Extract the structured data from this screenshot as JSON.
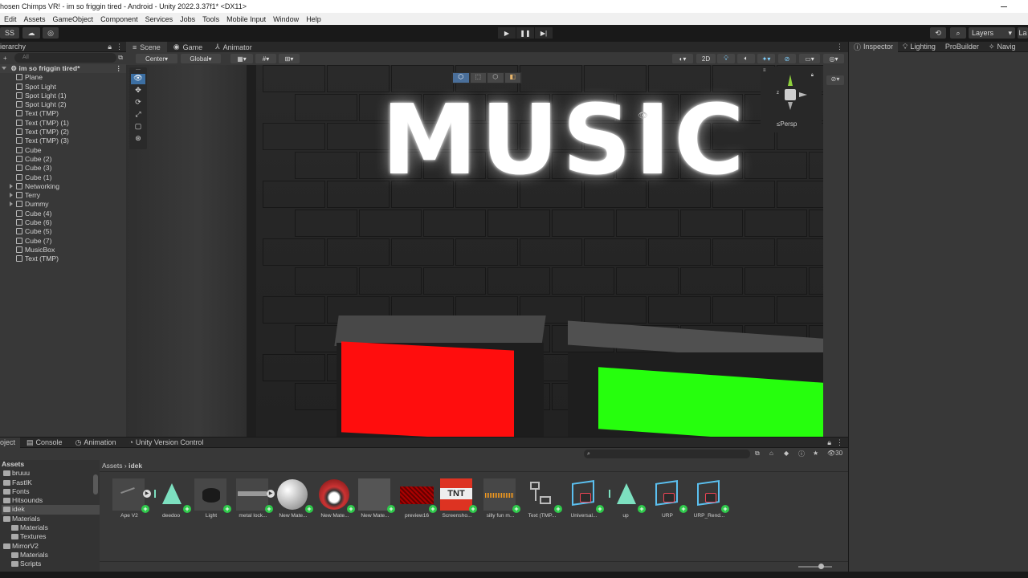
{
  "window": {
    "title": "hosen Chimps VR! - im so friggin tired - Android - Unity 2022.3.37f1* <DX11>"
  },
  "menu": [
    "Edit",
    "Assets",
    "GameObject",
    "Component",
    "Services",
    "Jobs",
    "Tools",
    "Mobile Input",
    "Window",
    "Help"
  ],
  "toolbar": {
    "account_label": "SS",
    "layers_label": "Layers",
    "layout_label": "La"
  },
  "hierarchy": {
    "tab_label": "ierarchy",
    "search_placeholder": "All",
    "scene_name": "im so friggin tired*",
    "items": [
      {
        "label": "Plane",
        "expandable": false
      },
      {
        "label": "Spot Light",
        "expandable": false
      },
      {
        "label": "Spot Light (1)",
        "expandable": false
      },
      {
        "label": "Spot Light (2)",
        "expandable": false
      },
      {
        "label": "Text (TMP)",
        "expandable": false
      },
      {
        "label": "Text (TMP) (1)",
        "expandable": false
      },
      {
        "label": "Text (TMP) (2)",
        "expandable": false
      },
      {
        "label": "Text (TMP) (3)",
        "expandable": false
      },
      {
        "label": "Cube",
        "expandable": false
      },
      {
        "label": "Cube (2)",
        "expandable": false
      },
      {
        "label": "Cube (3)",
        "expandable": false
      },
      {
        "label": "Cube (1)",
        "expandable": false
      },
      {
        "label": "Networking",
        "expandable": true
      },
      {
        "label": "Terry",
        "expandable": true
      },
      {
        "label": "Dummy",
        "expandable": true
      },
      {
        "label": "Cube (4)",
        "expandable": false
      },
      {
        "label": "Cube (6)",
        "expandable": false
      },
      {
        "label": "Cube (5)",
        "expandable": false
      },
      {
        "label": "Cube (7)",
        "expandable": false
      },
      {
        "label": "MusicBox",
        "expandable": false
      },
      {
        "label": "Text (TMP)",
        "expandable": false
      }
    ]
  },
  "scene": {
    "tabs": [
      "Scene",
      "Game",
      "Animator"
    ],
    "pivot_label": "Center",
    "space_label": "Global",
    "mode_2d": "2D",
    "persp_label": "Persp",
    "world_text": "MUSIC",
    "colors": {
      "red_block": "#ff0d0d",
      "green_block": "#26ff0d"
    }
  },
  "inspector": {
    "tabs": [
      "Inspector",
      "Lighting",
      "ProBuilder",
      "Navig"
    ]
  },
  "project": {
    "tabs": [
      "oject",
      "Console",
      "Animation",
      "Unity Version Control"
    ],
    "breadcrumb": [
      "Assets",
      "idek"
    ],
    "item_count": "30",
    "tree": [
      {
        "label": "Assets",
        "level": 0,
        "bold": true
      },
      {
        "label": "bruuu",
        "level": 0
      },
      {
        "label": "FastIK",
        "level": 0
      },
      {
        "label": "Fonts",
        "level": 0
      },
      {
        "label": "Hitsounds",
        "level": 0
      },
      {
        "label": "idek",
        "level": 0,
        "selected": true
      },
      {
        "label": "Materials",
        "level": 0
      },
      {
        "label": "Materials",
        "level": 1
      },
      {
        "label": "Textures",
        "level": 1
      },
      {
        "label": "MirrorV2",
        "level": 0
      },
      {
        "label": "Materials",
        "level": 1
      },
      {
        "label": "Scripts",
        "level": 1
      }
    ],
    "assets": [
      {
        "label": "Ape V2",
        "icon": "model-icon"
      },
      {
        "label": "deedoo",
        "icon": "cone-icon"
      },
      {
        "label": "Light",
        "icon": "cylinder-icon"
      },
      {
        "label": "metal lock...",
        "icon": "plank-icon"
      },
      {
        "label": "New Mate...",
        "icon": "sphere-icon"
      },
      {
        "label": "New Mate...",
        "icon": "red-sphere-icon"
      },
      {
        "label": "New Mate...",
        "icon": "grey-square-icon"
      },
      {
        "label": "preview16",
        "icon": "red-texture-icon"
      },
      {
        "label": "Screensho...",
        "icon": "tnt-icon"
      },
      {
        "label": "silly fun m...",
        "icon": "audio-icon"
      },
      {
        "label": "Text (TMP...",
        "icon": "prefab-link-icon"
      },
      {
        "label": "Universal...",
        "icon": "box-icon"
      },
      {
        "label": "up",
        "icon": "cone-icon"
      },
      {
        "label": "URP",
        "icon": "box-icon"
      },
      {
        "label": "URP_Rend...",
        "icon": "box-icon"
      }
    ]
  }
}
